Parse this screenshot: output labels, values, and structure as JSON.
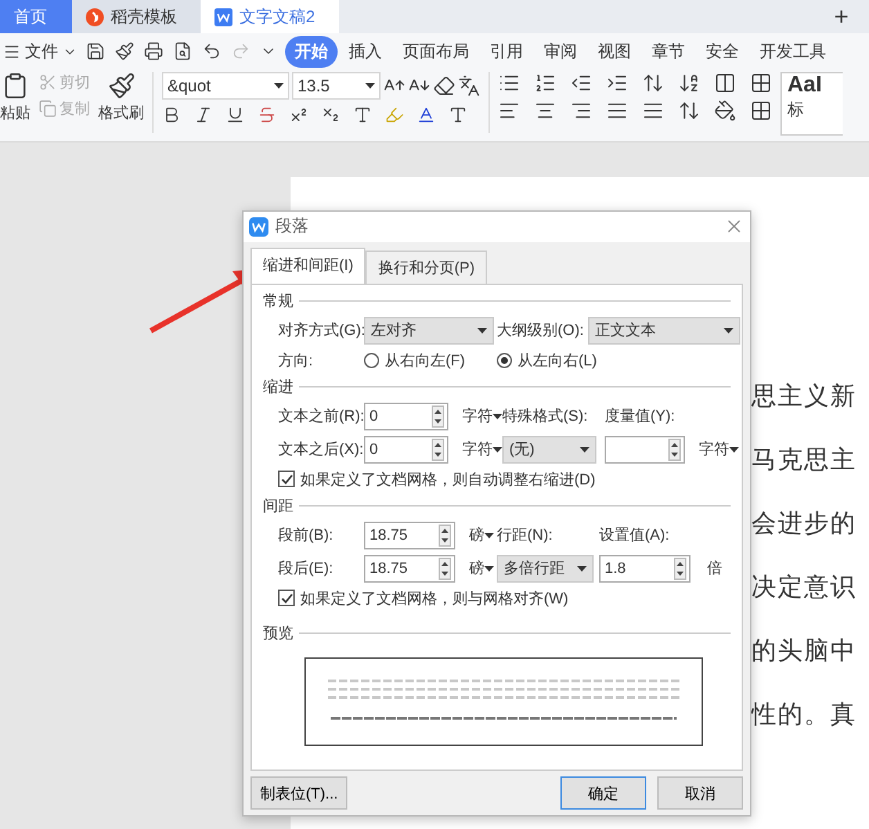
{
  "tabs": [
    {
      "label": "首页",
      "selected": false,
      "kind": "home"
    },
    {
      "label": "稻壳模板",
      "selected": false,
      "kind": "template"
    },
    {
      "label": "文字文稿2",
      "selected": true,
      "kind": "doc"
    }
  ],
  "new_tab": "+",
  "menu": {
    "file": "文件",
    "ribbon_tabs": [
      {
        "label": "开始",
        "selected": true
      },
      {
        "label": "插入",
        "selected": false
      },
      {
        "label": "页面布局",
        "selected": false
      },
      {
        "label": "引用",
        "selected": false
      },
      {
        "label": "审阅",
        "selected": false
      },
      {
        "label": "视图",
        "selected": false
      },
      {
        "label": "章节",
        "selected": false
      },
      {
        "label": "安全",
        "selected": false
      },
      {
        "label": "开发工具",
        "selected": false
      }
    ]
  },
  "toolbar": {
    "paste": "粘贴",
    "cut": {
      "label": "剪切",
      "disabled": true
    },
    "copy": {
      "label": "复制",
      "disabled": true
    },
    "format_painter": "格式刷",
    "font": "&quot",
    "size": "13.5",
    "style_sample": "AaI",
    "style_label": "标"
  },
  "document": {
    "lines": [
      "思主义新",
      "马克思主",
      "会进步的",
      "决定意识",
      "的头脑中",
      "性的。真"
    ]
  },
  "dialog": {
    "title": "段落",
    "tabs": [
      {
        "label": "缩进和间距(I)",
        "selected": true
      },
      {
        "label": "换行和分页(P)",
        "selected": false
      }
    ],
    "general": {
      "title": "常规",
      "alignment": {
        "label": "对齐方式(G):",
        "value": "左对齐"
      },
      "outline": {
        "label": "大纲级别(O):",
        "value": "正文文本"
      },
      "direction": {
        "label": "方向:",
        "options": [
          {
            "label": "从右向左(F)",
            "selected": false
          },
          {
            "label": "从左向右(L)",
            "selected": true
          }
        ]
      }
    },
    "indent": {
      "title": "缩进",
      "before": {
        "label": "文本之前(R):",
        "value": "0",
        "unit": "字符"
      },
      "after": {
        "label": "文本之后(X):",
        "value": "0",
        "unit": "字符"
      },
      "special": {
        "label": "特殊格式(S):",
        "value": "(无)"
      },
      "measure": {
        "label": "度量值(Y):",
        "unit": "字符"
      },
      "auto_adjust": {
        "label": "如果定义了文档网格，则自动调整右缩进(D)",
        "checked": true
      }
    },
    "spacing": {
      "title": "间距",
      "before": {
        "label": "段前(B):",
        "value": "18.75",
        "unit": "磅"
      },
      "after": {
        "label": "段后(E):",
        "value": "18.75",
        "unit": "磅"
      },
      "line": {
        "label": "行距(N):",
        "value": "多倍行距"
      },
      "setting": {
        "label": "设置值(A):",
        "value": "1.8",
        "unit": "倍"
      },
      "snap": {
        "label": "如果定义了文档网格，则与网格对齐(W)",
        "checked": true
      }
    },
    "preview": {
      "title": "预览"
    },
    "buttons": [
      {
        "label": "制表位(T)...",
        "kind": "tabs"
      },
      {
        "label": "确定",
        "kind": "primary"
      },
      {
        "label": "取消",
        "kind": "normal"
      }
    ]
  }
}
